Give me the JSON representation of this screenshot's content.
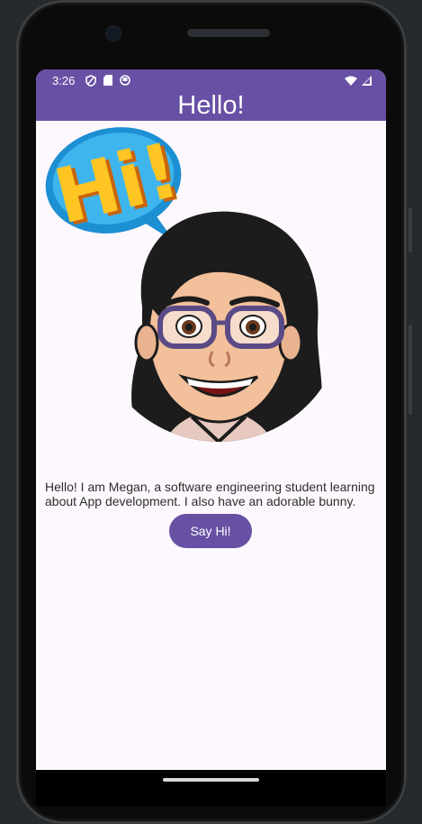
{
  "status_bar": {
    "time": "3:26",
    "left_icons": [
      "shield-icon",
      "sd-card-icon",
      "notification-icon"
    ],
    "right_icons": [
      "wifi-icon",
      "signal-icon"
    ]
  },
  "app_bar": {
    "title": "Hello!"
  },
  "content": {
    "sticker_text": "Hi!",
    "bio": "Hello! I am Megan, a software engineering student learning about App development. I also have an adorable bunny.",
    "button_label": "Say Hi!"
  },
  "colors": {
    "primary": "#6850a4",
    "background": "#fdf8fd",
    "text": "#2d2d2d"
  }
}
